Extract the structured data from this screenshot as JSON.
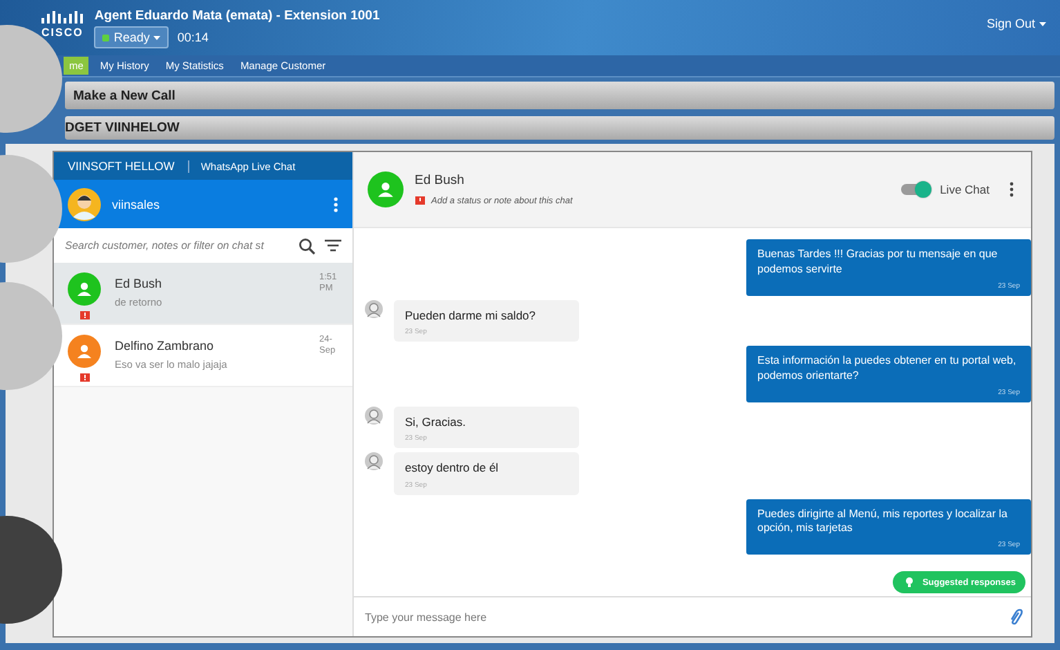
{
  "app": {
    "logo": "CISCO",
    "agent_title": "Agent Eduardo Mata (emata) - Extension 1001",
    "status": "Ready",
    "timer": "00:14",
    "sign_out": "Sign Out"
  },
  "nav_tabs": [
    {
      "label": "me",
      "selected": true
    },
    {
      "label": "My History",
      "selected": false
    },
    {
      "label": "My Statistics",
      "selected": false
    },
    {
      "label": "Manage Customer",
      "selected": false
    }
  ],
  "panels": [
    {
      "title": "Make a New Call"
    },
    {
      "title": "DGET VIINHELOW"
    }
  ],
  "sidebar": {
    "brand": "VIINSOFT HELLOW",
    "tab": "WhatsApp Live Chat",
    "user": "viinsales",
    "search": {
      "placeholder": "Search customer, notes or filter on chat st"
    },
    "chats": [
      {
        "name": "Ed Bush",
        "preview": "de retorno",
        "time": "1:51 PM",
        "color": "#1ec31e",
        "selected": true,
        "flagged": true
      },
      {
        "name": "Delfino Zambrano",
        "preview": "Eso va ser lo malo jajaja",
        "time": "24-Sep",
        "color": "#f5821f",
        "selected": false,
        "flagged": true
      }
    ]
  },
  "conversation": {
    "contact": "Ed Bush",
    "note_hint": "Add a status or note about this chat",
    "live_chat": {
      "label": "Live Chat",
      "on": true
    },
    "messages": [
      {
        "kind": "sent",
        "text": "Buenas Tardes !!! Gracias por tu mensaje en que podemos servirte",
        "date": "23 Sep"
      },
      {
        "kind": "received",
        "text": "Pueden darme mi saldo?",
        "date": "23 Sep"
      },
      {
        "kind": "sent",
        "text": "Esta información la puedes obtener en tu portal web, podemos orientarte?",
        "date": "23 Sep"
      },
      {
        "kind": "received",
        "text": "Si, Gracias.",
        "date": "23 Sep"
      },
      {
        "kind": "received",
        "text": "estoy dentro de él",
        "date": "23 Sep"
      },
      {
        "kind": "sent",
        "text": "Puedes dirigirte al Menú, mis reportes y localizar la opción, mis tarjetas",
        "date": "23 Sep"
      }
    ],
    "suggested": "Suggested responses",
    "composer": {
      "placeholder": "Type your message here"
    }
  }
}
